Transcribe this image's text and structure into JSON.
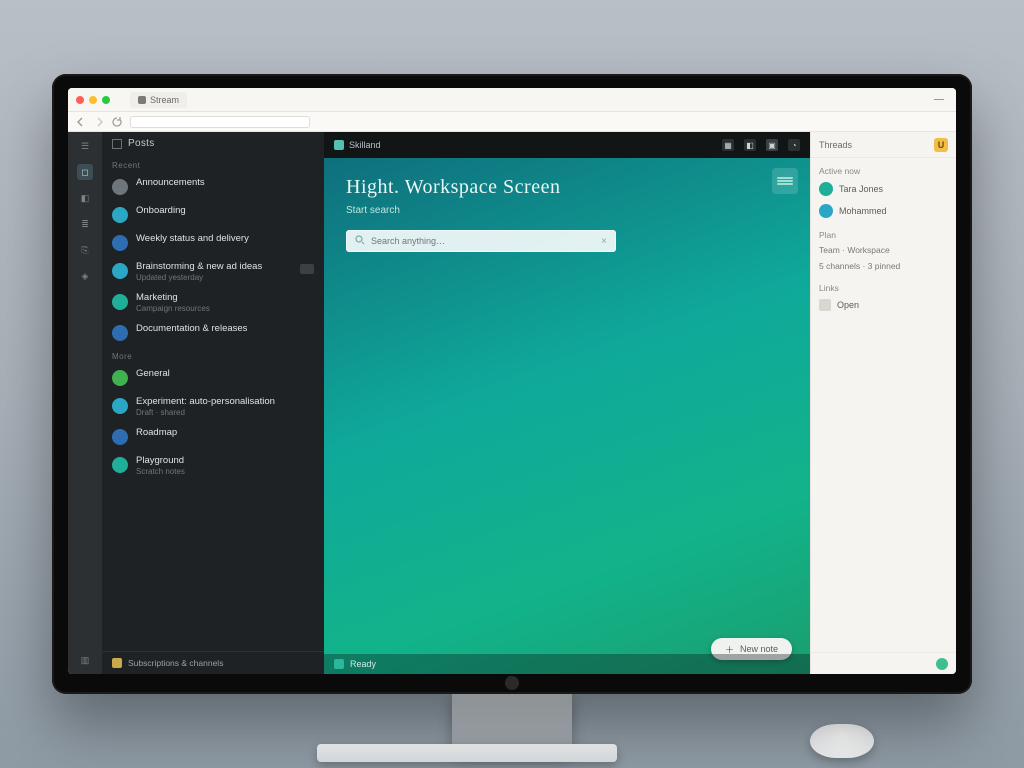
{
  "chrome": {
    "tab_label": "Stream",
    "url_placeholder": ""
  },
  "app": {
    "brand": "Skilland",
    "top_icons": [
      "grid-icon",
      "apps-icon",
      "inbox-icon",
      "bell-icon"
    ]
  },
  "rail": {
    "items": [
      {
        "name": "menu-icon",
        "glyph": "☰"
      },
      {
        "name": "home-icon",
        "glyph": "◻"
      },
      {
        "name": "chat-icon",
        "glyph": "◧"
      },
      {
        "name": "list-icon",
        "glyph": "≣"
      },
      {
        "name": "link-icon",
        "glyph": "⎘"
      },
      {
        "name": "tag-icon",
        "glyph": "◈"
      }
    ],
    "footer": {
      "name": "folder-icon",
      "glyph": "▥"
    }
  },
  "leftlist": {
    "heading": "Posts",
    "section1": "Recent",
    "section2": "More",
    "items": [
      {
        "title": "Announcements",
        "desc": "",
        "avatar": "av-grey",
        "badge": false
      },
      {
        "title": "Onboarding",
        "desc": "",
        "avatar": "av-cyan",
        "badge": false
      },
      {
        "title": "Weekly status and delivery",
        "desc": "",
        "avatar": "av-blue",
        "badge": false
      },
      {
        "title": "Brainstorming & new ad ideas",
        "desc": "Updated yesterday",
        "avatar": "av-cyan",
        "badge": true
      },
      {
        "title": "Marketing",
        "desc": "Campaign resources",
        "avatar": "av-teal",
        "badge": false
      },
      {
        "title": "Documentation & releases",
        "desc": "",
        "avatar": "av-blue",
        "badge": false
      },
      {
        "title": "General",
        "desc": "",
        "avatar": "av-green",
        "badge": false
      },
      {
        "title": "Experiment: auto-personalisation",
        "desc": "Draft · shared",
        "avatar": "av-cyan",
        "badge": false
      },
      {
        "title": "Roadmap",
        "desc": "",
        "avatar": "av-blue",
        "badge": false
      },
      {
        "title": "Playground",
        "desc": "Scratch notes",
        "avatar": "av-teal",
        "badge": false
      }
    ],
    "footer": "Subscriptions & channels"
  },
  "center": {
    "title": "Hight. Workspace Screen",
    "subtitle": "Start search",
    "search_placeholder": "Search anything…",
    "pill_label": "New note",
    "status_label": "Ready",
    "corner_name": "preview-card"
  },
  "right": {
    "header": "Threads",
    "badge": "U",
    "section_people": "Active now",
    "people": [
      {
        "name": "Tara Jones",
        "avatar": "av-teal"
      },
      {
        "name": "Mohammed",
        "avatar": "av-cyan"
      }
    ],
    "section_info": "Plan",
    "info_lines": [
      "Team · Workspace",
      "5 channels · 3 pinned"
    ],
    "section_links": "Links",
    "link_label": "Open",
    "foot_name": "status-online-icon"
  }
}
